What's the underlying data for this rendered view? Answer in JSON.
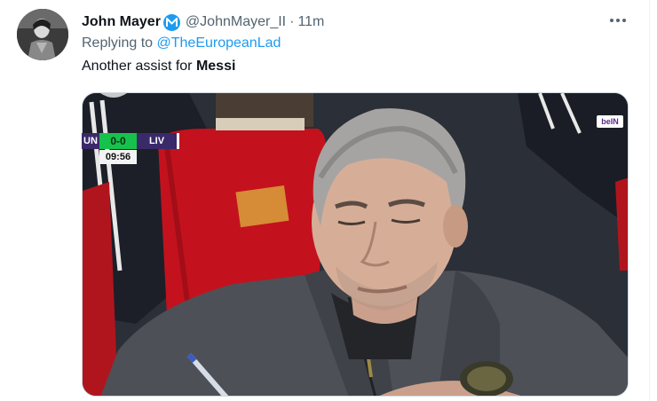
{
  "tweet": {
    "author": {
      "display_name": "John Mayer",
      "handle": "@JohnMayer_II",
      "verified_icon": "verified-m-badge-icon",
      "avatar_icon": "avatar-photo"
    },
    "separator": "·",
    "time": "11m",
    "reply": {
      "prefix": "Replying to",
      "mention": "@TheEuropeanLad"
    },
    "text": {
      "plain": "Another assist for",
      "bold": "Messi"
    },
    "more_icon": "more-dots-icon",
    "media": {
      "scorebug": {
        "home": "UN",
        "score": "0-0",
        "away": "LIV",
        "clock": "09:56"
      },
      "broadcaster_logo": "beIN"
    }
  },
  "colors": {
    "link": "#1d9bf0",
    "secondary_text": "#536471",
    "primary_text": "#0f1419",
    "score_green": "#17c24c",
    "score_purple": "#3a2a6a"
  }
}
